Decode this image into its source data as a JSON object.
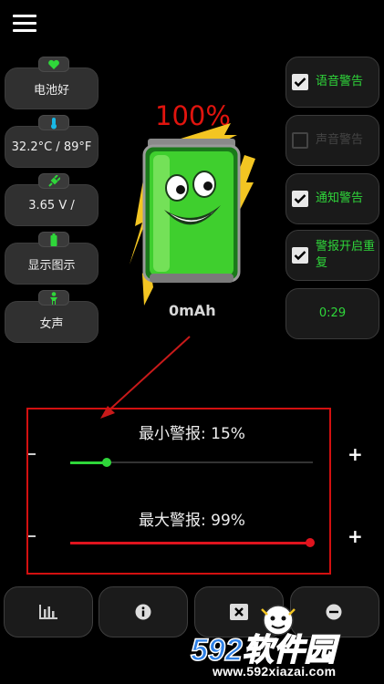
{
  "left_panel": {
    "items": [
      {
        "label": "电池好",
        "icon": "heart-icon",
        "icon_color": "#2fd63a"
      },
      {
        "label": "32.2°C / 89°F",
        "icon": "thermometer-icon",
        "icon_color": "#19b8e6"
      },
      {
        "label": "3.65 V /",
        "icon": "plug-icon",
        "icon_color": "#2fd63a"
      },
      {
        "label": "显示图示",
        "icon": "battery-small-icon",
        "icon_color": "#2fd63a"
      },
      {
        "label": "女声",
        "icon": "person-icon",
        "icon_color": "#2fd63a"
      }
    ]
  },
  "right_panel": {
    "voice_alert": {
      "label": "语音警告",
      "checked": true
    },
    "sound_alert": {
      "label": "声音警告",
      "checked": false
    },
    "notify_alert": {
      "label": "通知警告",
      "checked": true
    },
    "alarm_repeat": {
      "label": "警报开启重复",
      "checked": true
    },
    "timer": "0:29"
  },
  "battery": {
    "percent": "100%",
    "capacity": "0mAh"
  },
  "alarms": {
    "min": {
      "label": "最小警报: 15%",
      "value": 15
    },
    "max": {
      "label": "最大警报: 99%",
      "value": 99
    }
  },
  "bottom_bar": {
    "buttons": [
      "chart-icon",
      "info-icon",
      "close-icon",
      "minus-circle-icon"
    ]
  },
  "watermark": {
    "brand": "592软件园",
    "url": "www.592xiazai.com"
  },
  "colors": {
    "accent_green": "#2fd63a",
    "alarm_red": "#d31010",
    "min_slider": "#2fd63a",
    "max_slider": "#e0141e"
  }
}
